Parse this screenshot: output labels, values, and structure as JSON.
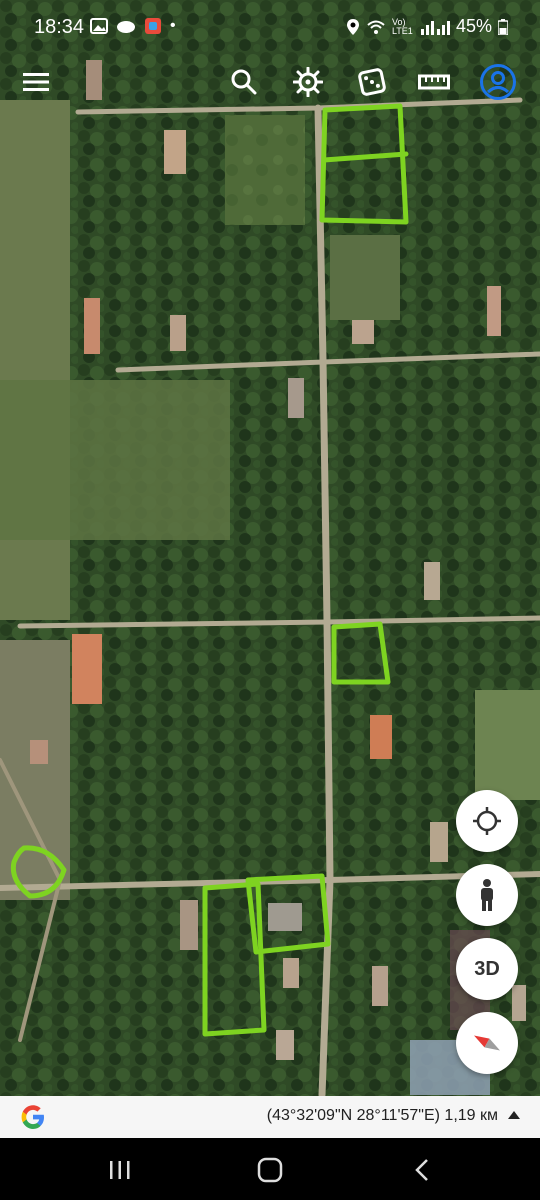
{
  "status_bar": {
    "time": "18:34",
    "network": "Vo) LTE1",
    "battery": "45%"
  },
  "toolbar": {
    "icons": [
      "menu-icon",
      "search-icon",
      "ship-wheel-icon",
      "dice-icon",
      "ruler-icon",
      "profile-icon"
    ]
  },
  "controls": {
    "three_d_label": "3D"
  },
  "bottom_bar": {
    "coordinates": "(43°32'09\"N 28°11'57\"E) 1,19 км"
  },
  "colors": {
    "highlight": "#7ed321",
    "accent": "#1a73e8"
  }
}
